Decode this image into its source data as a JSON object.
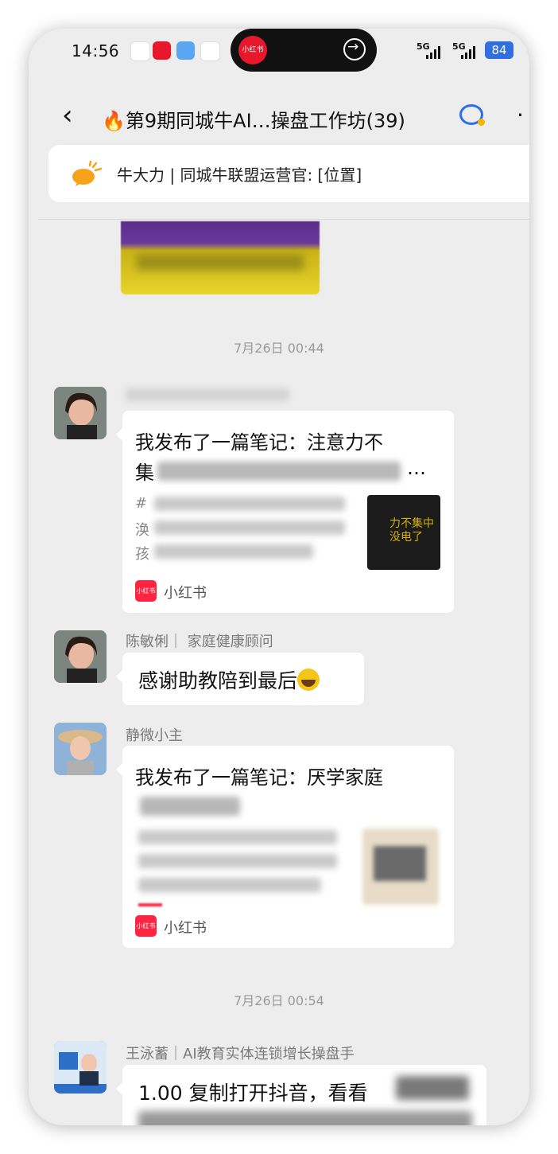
{
  "status_bar": {
    "time": "14:56",
    "battery": "84",
    "network_1": "5G",
    "network_2": "5G",
    "island_app": "小红书"
  },
  "header": {
    "title": "🔥第9期同城牛AI…操盘工作坊(39)",
    "back_icon": "chevron-left-icon",
    "more_icon": "more-dots-icon"
  },
  "pinned_notice": {
    "text": "牛大力 | 同城牛联盟运营官: [位置]"
  },
  "timestamps": {
    "first": "7月26日 00:44",
    "second": "7月26日 00:54"
  },
  "messages": [
    {
      "type": "card",
      "title_line1": "我发布了一篇笔记：注意力不",
      "title_line2_prefix": "集",
      "title_line2_suffix": "…",
      "desc_start_1": "#",
      "desc_start_2": "涣",
      "desc_start_3": "孩",
      "thumb_text": "力不集中\n没电了",
      "source": "小红书"
    },
    {
      "type": "text",
      "sender": "陈敏俐｜ 家庭健康顾问",
      "text": "感谢助教陪到最后"
    },
    {
      "type": "card",
      "sender": "静微小主",
      "title_line1": "我发布了一篇笔记：厌学家庭",
      "source": "小红书"
    },
    {
      "type": "text",
      "sender": "王泳蓄｜AI教育实体连锁增长操盘手",
      "text": "1.00 复制打开抖音，看看"
    }
  ],
  "colors": {
    "xiaohongshu_red": "#ff2442",
    "battery_blue": "#2f6fe0",
    "chat_bg": "#ededed"
  }
}
